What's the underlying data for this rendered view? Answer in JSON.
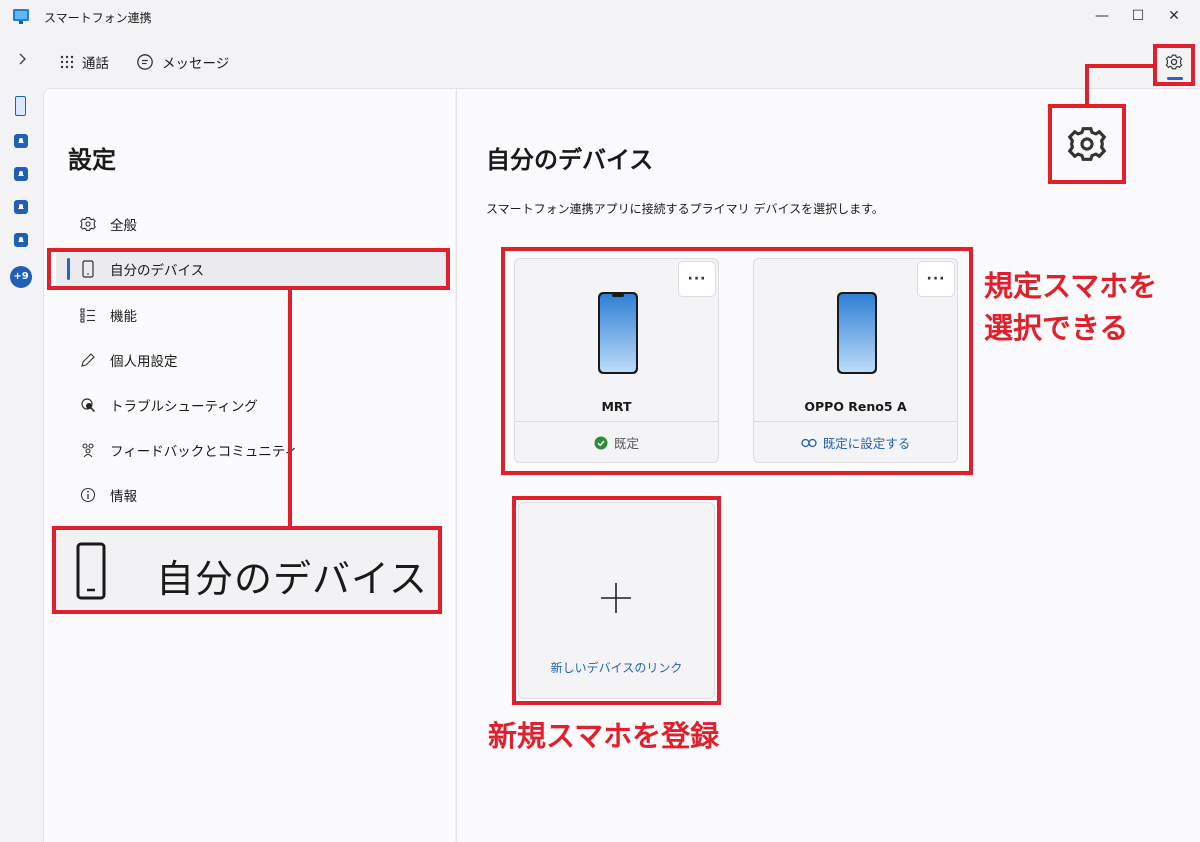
{
  "window": {
    "title": "スマートフォン連携",
    "minimize": "—",
    "maximize": "☐",
    "close": "✕"
  },
  "toolbar": {
    "calls_label": "通話",
    "messages_label": "メッセージ"
  },
  "rail": {
    "more_badge": "+9"
  },
  "settings": {
    "title": "設定",
    "nav": [
      {
        "label": "全般",
        "icon": "gear-icon"
      },
      {
        "label": "自分のデバイス",
        "icon": "phone-icon"
      },
      {
        "label": "機能",
        "icon": "list-icon"
      },
      {
        "label": "個人用設定",
        "icon": "pen-icon"
      },
      {
        "label": "トラブルシューティング",
        "icon": "troubleshoot-icon"
      },
      {
        "label": "フィードバックとコミュニティ",
        "icon": "people-icon"
      },
      {
        "label": "情報",
        "icon": "info-icon"
      }
    ]
  },
  "devices": {
    "title": "自分のデバイス",
    "description": "スマートフォン連携アプリに接続するプライマリ デバイスを選択します。",
    "cards": [
      {
        "name": "MRT",
        "status": "既定",
        "more": "···"
      },
      {
        "name": "OPPO Reno5 A",
        "status": "既定に設定する",
        "more": "···"
      }
    ],
    "add_label": "新しいデバイスのリンク"
  },
  "annotations": {
    "zoom_label": "自分のデバイス",
    "callout_select_line1": "規定スマホを",
    "callout_select_line2": "選択できる",
    "callout_register": "新規スマホを登録"
  },
  "colors": {
    "accent": "#2764c6",
    "annotation_red": "#e0202a",
    "default_green": "#2e8b3a"
  }
}
